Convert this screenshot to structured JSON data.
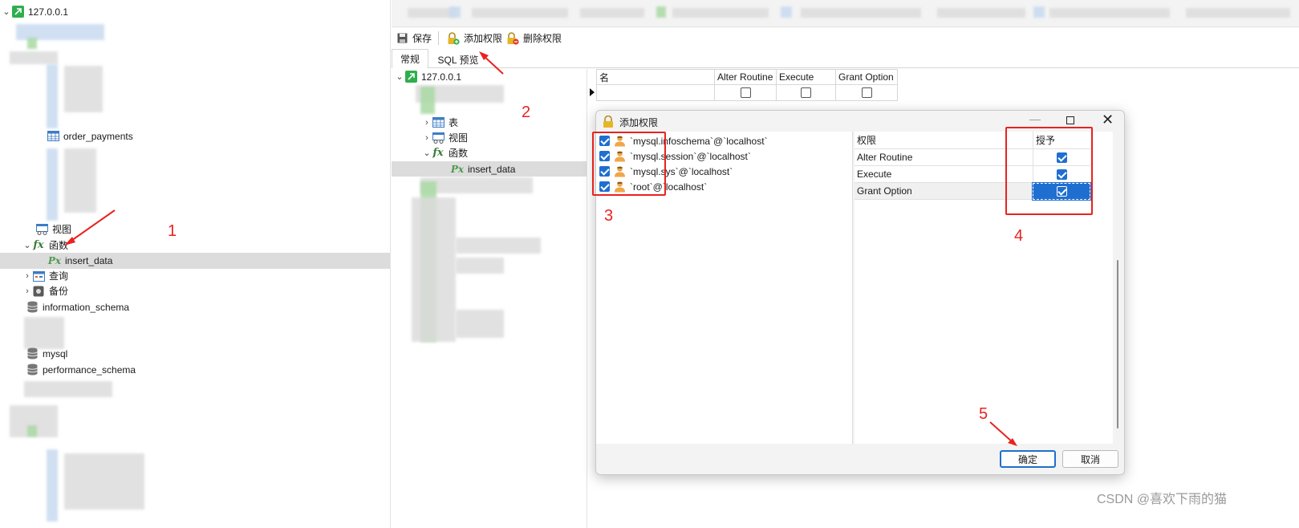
{
  "left_tree": {
    "connection": "127.0.0.1",
    "table_item": "order_payments",
    "views": "视图",
    "functions": "函数",
    "function_item": "insert_data",
    "queries": "查询",
    "backups": "备份",
    "databases": [
      "information_schema",
      "mysql",
      "performance_schema"
    ]
  },
  "toolbar": {
    "save": "保存",
    "add_privilege": "添加权限",
    "delete_privilege": "删除权限"
  },
  "tabs": {
    "general": "常规",
    "sql_preview": "SQL 预览"
  },
  "mid_tree": {
    "connection": "127.0.0.1",
    "tables": "表",
    "views": "视图",
    "functions": "函数",
    "function_item": "insert_data"
  },
  "grid": {
    "headers": [
      "名",
      "Alter Routine",
      "Execute",
      "Grant Option"
    ]
  },
  "dialog": {
    "title": "添加权限",
    "users": [
      "`mysql.infoschema`@`localhost`",
      "`mysql.session`@`localhost`",
      "`mysql.sys`@`localhost`",
      "`root`@`localhost`"
    ],
    "perm_header": "权限",
    "grant_header": "授予",
    "permissions": [
      {
        "name": "Alter Routine",
        "granted": true
      },
      {
        "name": "Execute",
        "granted": true
      },
      {
        "name": "Grant Option",
        "granted": true
      }
    ],
    "ok": "确定",
    "cancel": "取消"
  },
  "annotations": [
    "1",
    "2",
    "3",
    "4",
    "5"
  ],
  "watermark": "CSDN @喜欢下雨的猫",
  "colors": {
    "accent": "#1f6fd0",
    "annotation_red": "#e8231f",
    "selection": "#dcdcdc"
  }
}
